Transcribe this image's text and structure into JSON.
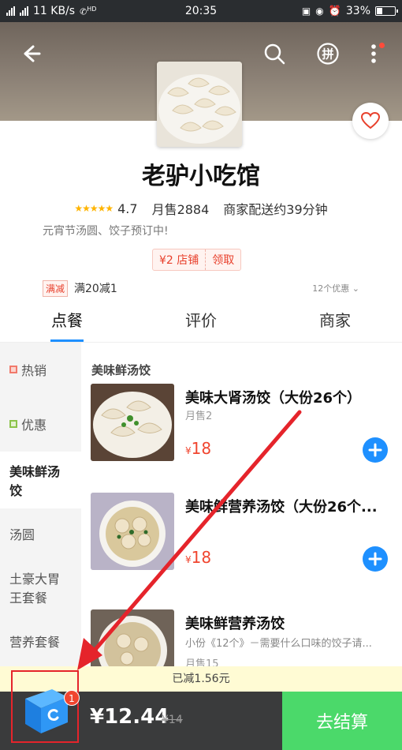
{
  "status_bar": {
    "network_speed": "11 KB/s",
    "hd_label": "HD",
    "time": "20:35",
    "battery": "33%",
    "battery_level": 0.33
  },
  "header": {
    "back_icon": "back-arrow-icon",
    "search_icon": "search-icon",
    "group_icon": "pin-group-icon",
    "group_glyph": "拼",
    "more_icon": "more-vertical-icon",
    "favorite_icon": "heart-outline-icon"
  },
  "shop": {
    "name": "老驴小吃馆",
    "rating": "4.7",
    "monthly_sales": "月售2884",
    "delivery_time": "商家配送约39分钟",
    "notice": "元宵节汤圆、饺子预订中!",
    "coupon_amount": "¥2 店铺",
    "coupon_claim": "领取",
    "promo_tag": "满减",
    "promo_text": "满20减1",
    "promo_more": "12个优惠"
  },
  "tabs": [
    {
      "label": "点餐",
      "active": true
    },
    {
      "label": "评价",
      "active": false
    },
    {
      "label": "商家",
      "active": false
    }
  ],
  "sidebar": {
    "items": [
      {
        "label": "热销",
        "marker_color": "#f17a6c"
      },
      {
        "label": "优惠",
        "marker_color": "#8bc34a"
      },
      {
        "label": "美味鲜汤饺",
        "active": true
      },
      {
        "label": "汤圆"
      },
      {
        "label": "土豪大胃王套餐"
      },
      {
        "label": "营养套餐"
      }
    ]
  },
  "menu": {
    "category_title": "美味鲜汤饺",
    "items": [
      {
        "name": "美味大肾汤饺（大份26个）",
        "sales": "月售2",
        "price_symbol": "¥",
        "price": "18"
      },
      {
        "name": "美味鲜营养汤饺（大份26个...",
        "price_symbol": "¥",
        "price": "18"
      },
      {
        "name": "美味鲜营养汤饺",
        "desc": "小份《12个》－需要什么口味的饺子请...",
        "sales": "月售15"
      }
    ]
  },
  "cart": {
    "discount_text": "已减1.56元",
    "badge_count": "1",
    "total": "¥12.44",
    "original": "¥14",
    "checkout_label": "去结算"
  },
  "colors": {
    "accent_blue": "#1e90ff",
    "price_red": "#f0452f",
    "checkout_green": "#4bd96a",
    "annotation_red": "#e5242b"
  }
}
